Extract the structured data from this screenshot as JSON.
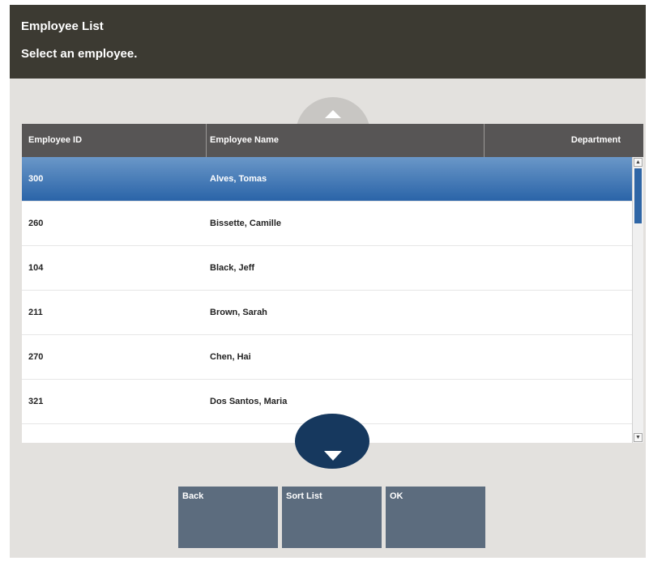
{
  "header": {
    "title": "Employee List",
    "prompt": "Select an employee."
  },
  "table": {
    "columns": [
      "Employee ID",
      "Employee Name",
      "Department"
    ],
    "rows": [
      {
        "id": "300",
        "name": "Alves, Tomas",
        "department": "",
        "selected": true
      },
      {
        "id": "260",
        "name": "Bissette, Camille",
        "department": ""
      },
      {
        "id": "104",
        "name": "Black, Jeff",
        "department": ""
      },
      {
        "id": "211",
        "name": "Brown, Sarah",
        "department": ""
      },
      {
        "id": "270",
        "name": "Chen, Hai",
        "department": ""
      },
      {
        "id": "321",
        "name": "Dos Santos, Maria",
        "department": ""
      }
    ]
  },
  "icons": {
    "scroll_up": "triangle-up-icon",
    "scroll_down": "triangle-down-icon"
  },
  "buttons": {
    "back": "Back",
    "sort": "Sort List",
    "ok": "OK"
  },
  "colors": {
    "header_bg": "#3c3a32",
    "selected_row": "#2a64a8",
    "button_bg": "#5c6c7e",
    "scroll_down_bg": "#16385e"
  }
}
